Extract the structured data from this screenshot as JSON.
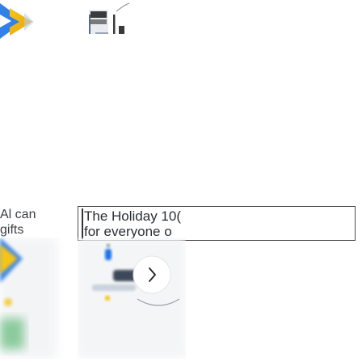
{
  "row": {
    "label_line1": "Al can",
    "label_line2": "gifts"
  },
  "preview_card": {
    "line1": "The Holiday 10(",
    "line2": "for everyone o"
  },
  "icons": {
    "top_left": "arrow-right-icon",
    "top_right": "mini-chart-icon",
    "bottom_left": "blurred-arrow-icon",
    "bottom_right": "chevron-right-icon"
  },
  "colors": {
    "sticker_yellow": "#f5c518",
    "sticker_blue": "#1a73e8",
    "sticker_green": "#34a853",
    "chart_dark": "#3a3a3a",
    "card_border": "#4a4a4a"
  }
}
